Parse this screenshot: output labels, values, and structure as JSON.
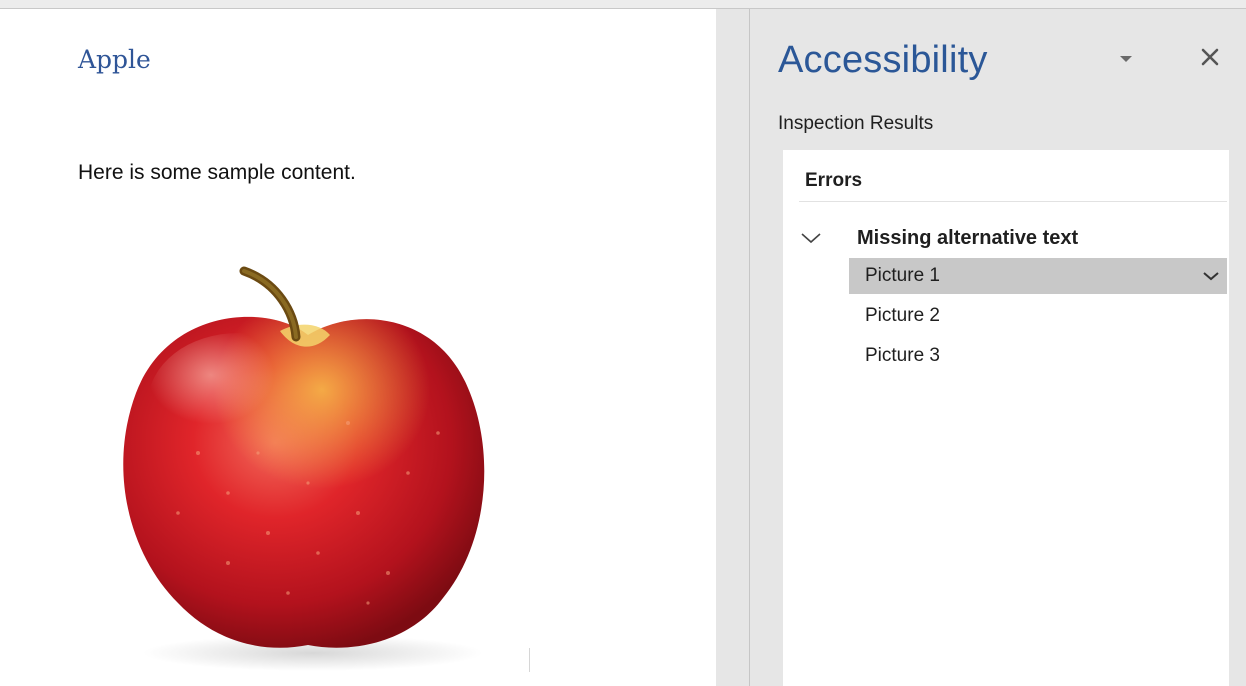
{
  "document": {
    "title": "Apple",
    "body_text": "Here is some sample content."
  },
  "pane": {
    "title": "Accessibility",
    "subtitle": "Inspection Results",
    "errors_heading": "Errors",
    "group_label": "Missing alternative text",
    "items": [
      {
        "label": "Picture 1",
        "selected": true
      },
      {
        "label": "Picture 2",
        "selected": false
      },
      {
        "label": "Picture 3",
        "selected": false
      }
    ],
    "icons": {
      "menu": "dropdown-triangle-icon",
      "close": "close-icon",
      "group_toggle": "chevron-down-icon",
      "item_action": "chevron-down-icon"
    }
  },
  "colors": {
    "heading_blue": "#2b5797",
    "pane_background": "#e6e6e6",
    "selected_row": "#c8c8c8"
  }
}
